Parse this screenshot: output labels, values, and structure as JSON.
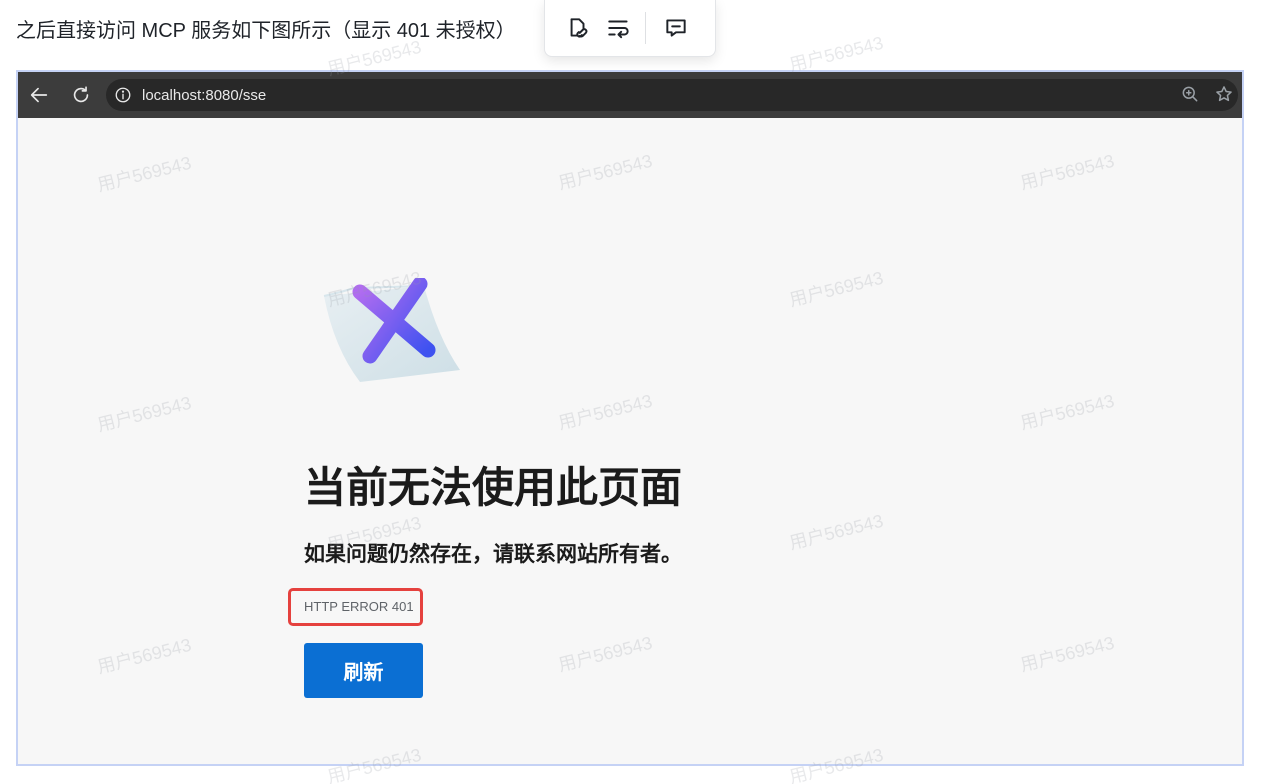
{
  "doc": {
    "intro_text": "之后直接访问 MCP 服务如下图所示（显示 401 未授权）",
    "watermark": "用户569543"
  },
  "popover": {
    "items": [
      {
        "icon": "link-icon"
      },
      {
        "icon": "wrap-text-icon"
      },
      {
        "icon": "comment-icon"
      }
    ]
  },
  "browser": {
    "url": "localhost:8080/sse",
    "icons": [
      "back-arrow-icon",
      "reload-icon",
      "info-icon",
      "zoom-icon",
      "star-icon"
    ]
  },
  "error_page": {
    "title": "当前无法使用此页面",
    "subtitle": "如果问题仍然存在，请联系网站所有者。",
    "code": "HTTP ERROR 401",
    "refresh_label": "刷新"
  },
  "colors": {
    "accent_button": "#0b6fd3",
    "highlight_box": "#e5413e",
    "screenshot_border": "#c5d2f5",
    "toolbar": "#3c3c3c"
  }
}
